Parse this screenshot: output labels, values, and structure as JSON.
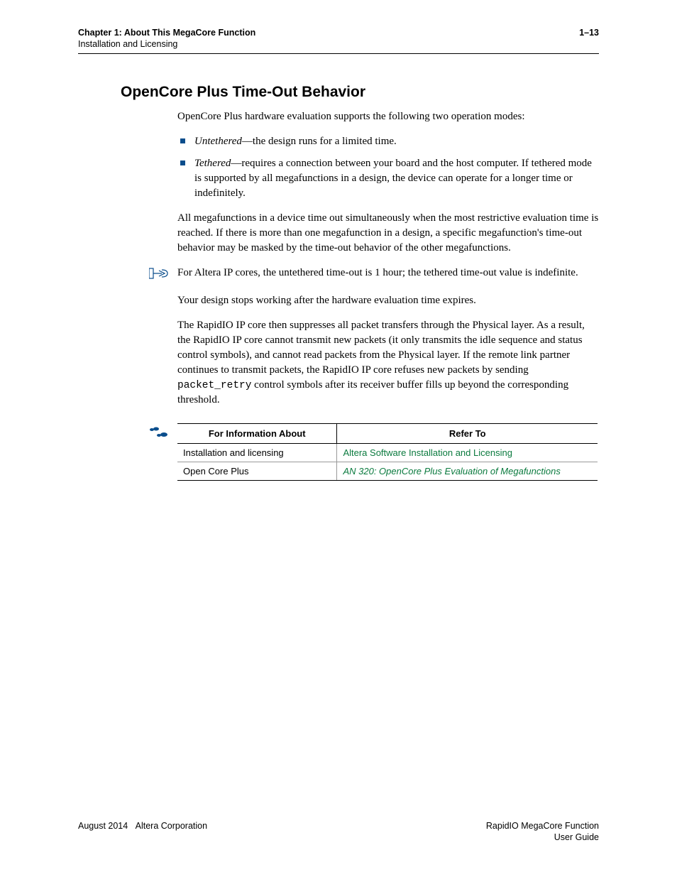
{
  "header": {
    "chapter_line": "Chapter 1: About This MegaCore Function",
    "sub_line": "Installation and Licensing",
    "page_num": "1–13"
  },
  "section": {
    "title": "OpenCore Plus Time-Out Behavior",
    "intro": "OpenCore Plus hardware evaluation supports the following two operation modes:",
    "bullets": [
      {
        "term": "Untethered",
        "rest": "—the design runs for a limited time."
      },
      {
        "term": "Tethered",
        "rest": "—requires a connection between your board and the host computer. If tethered mode is supported by all megafunctions in a design, the device can operate for a longer time or indefinitely."
      }
    ],
    "para2": "All megafunctions in a device time out simultaneously when the most restrictive evaluation time is reached. If there is more than one megafunction in a design, a specific megafunction's time-out behavior may be masked by the time-out behavior of the other megafunctions.",
    "note": "For Altera IP cores, the untethered time-out is 1 hour; the tethered time-out value is indefinite.",
    "para3": "Your design stops working after the hardware evaluation time expires.",
    "para4_a": "The RapidIO IP core then suppresses all packet transfers through the Physical layer. As a result, the RapidIO IP core cannot transmit new packets (it only transmits the idle sequence and status control symbols), and cannot read packets from the Physical layer. If the remote link partner continues to transmit packets, the RapidIO IP core refuses new packets by sending ",
    "para4_code": "packet_retry",
    "para4_b": " control symbols after its receiver buffer fills up beyond the corresponding threshold."
  },
  "table": {
    "headers": [
      "For Information About",
      "Refer To"
    ],
    "rows": [
      {
        "about": "Installation and licensing",
        "refer": "Altera Software Installation and Licensing",
        "italic": false
      },
      {
        "about": "Open Core Plus",
        "refer": "AN 320: OpenCore Plus Evaluation of Megafunctions",
        "italic": true
      }
    ]
  },
  "footer": {
    "left_date": "August 2014",
    "left_corp": "Altera Corporation",
    "right_line1": "RapidIO MegaCore Function",
    "right_line2": "User Guide"
  }
}
